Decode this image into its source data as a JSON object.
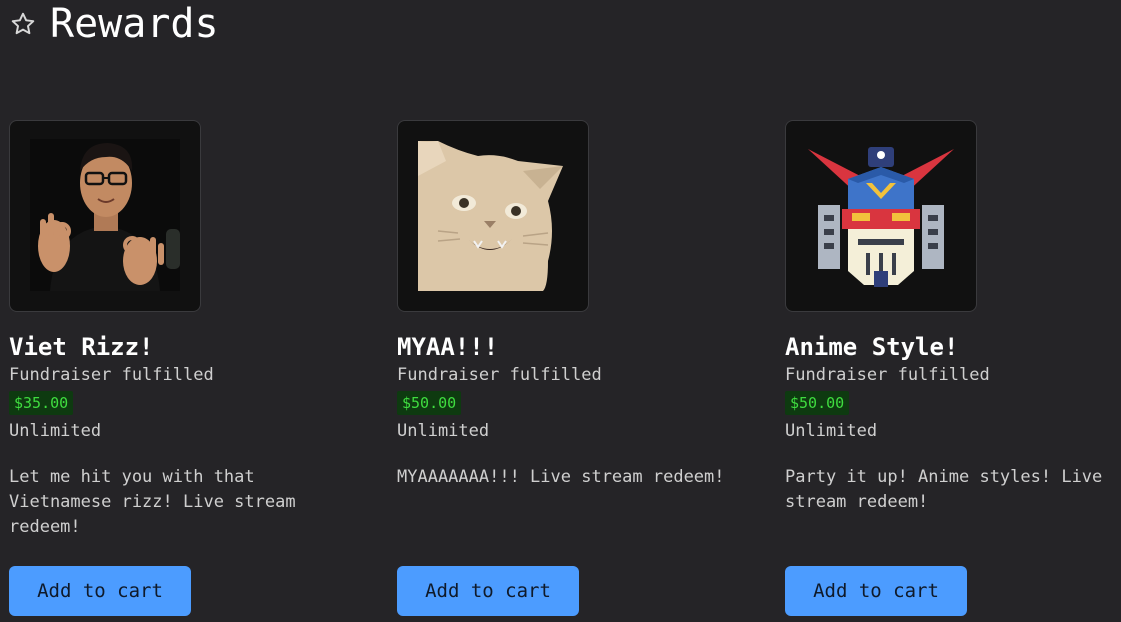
{
  "header": {
    "title": "Rewards",
    "icon": "star-outline-icon"
  },
  "rewards": [
    {
      "title": "Viet Rizz!",
      "status": "Fundraiser fulfilled",
      "price": "$35.00",
      "limit": "Unlimited",
      "description": "Let me hit you with that Vietnamese rizz! Live stream redeem!",
      "button": "Add to cart",
      "image": "man-hand-gesture-photo"
    },
    {
      "title": "MYAA!!!",
      "status": "Fundraiser fulfilled",
      "price": "$50.00",
      "limit": "Unlimited",
      "description": "MYAAAAAAA!!! Live stream redeem!",
      "button": "Add to cart",
      "image": "screaming-cat-photo"
    },
    {
      "title": "Anime Style!",
      "status": "Fundraiser fulfilled",
      "price": "$50.00",
      "limit": "Unlimited",
      "description": "Party it up! Anime styles! Live stream redeem!",
      "button": "Add to cart",
      "image": "robot-mecha-icon"
    }
  ],
  "colors": {
    "background": "#252427",
    "button": "#4c9cff",
    "price_bg": "#0e3a10",
    "price_text": "#3fdc3f"
  }
}
